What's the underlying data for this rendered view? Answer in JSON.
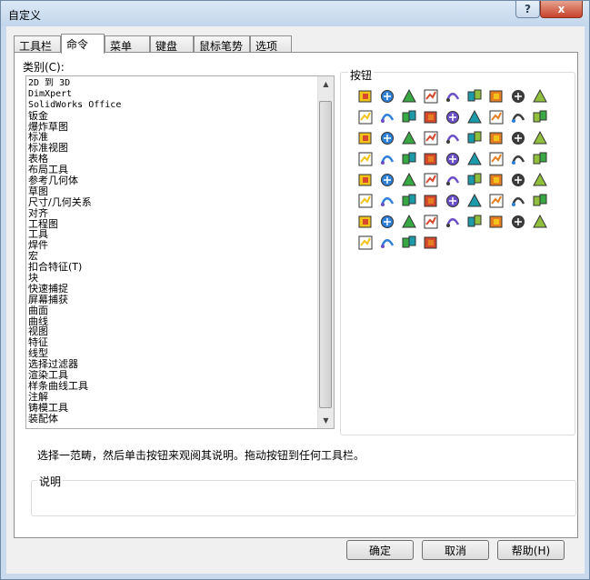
{
  "window": {
    "title": "自定义",
    "help": "?",
    "close": "x"
  },
  "tabs": [
    "工具栏",
    "命令",
    "菜单",
    "键盘",
    "鼠标笔势",
    "选项"
  ],
  "categories": {
    "label": "类别(C):",
    "items": [
      "2D 到 3D",
      "DimXpert",
      "SolidWorks Office",
      "钣金",
      "爆炸草图",
      "标准",
      "标准视图",
      "表格",
      "布局工具",
      "参考几何体",
      "草图",
      "尺寸/几何关系",
      "对齐",
      "工程图",
      "工具",
      "焊件",
      "宏",
      "扣合特征(T)",
      "块",
      "快速捕捉",
      "屏幕捕获",
      "曲面",
      "曲线",
      "视图",
      "特征",
      "线型",
      "选择过滤器",
      "渲染工具",
      "样条曲线工具",
      "注解",
      "铸模工具",
      "装配体"
    ]
  },
  "buttons": {
    "label": "按钮",
    "icons": [
      "import-3d-icon",
      "flowchart-icon",
      "text-a-icon",
      "box-3d-icon",
      "spiral-icon",
      "steps-icon",
      "target-icon",
      "grid-pattern-icon",
      "stairs-icon",
      "green-sphere-icon",
      "bold-italic-icon",
      "parallelogram-icon",
      "lines-icon",
      "bar-chart-icon",
      "frame-icon",
      "camera-target-icon",
      "sparkle-icon",
      "pie-chart-icon",
      "gear-icon",
      "cursor-icon",
      "pointer-click-icon",
      "percent-icon",
      "sw-3d-icon",
      "sw-r-icon",
      "save-disk-icon",
      "copy-pages-icon",
      "ruler-icon",
      "table-icon",
      "camera-icon",
      "part-cube-icon",
      "globe-icon",
      "chart-axis-icon",
      "picture-icon",
      "folder-open-icon",
      "floppy-icon",
      "printer-icon",
      "list-icon",
      "edit-pen-icon",
      "line-icon",
      "rectangle-icon",
      "slot-icon",
      "circle-dot-icon",
      "dotted-arc-icon",
      "ellipse-icon",
      "spline-icon",
      "point-plus-icon",
      "partial-rect-icon",
      "mirror-icon",
      "snap-grid-icon",
      "dot-grid-icon",
      "graph-icon",
      "move-icon",
      "sketch-box-icon",
      "cube-yellow-icon",
      "cylinder-icon",
      "pattern-dots-icon",
      "chain-icon",
      "folder-star-icon",
      "green-rects-icon",
      "rotate-icon",
      "assembly-icon",
      "swap-icon",
      "wave-icon",
      "screen-icon",
      "check-x-icon",
      "pliers-icon",
      "bar-step-icon"
    ]
  },
  "hint": "选择一范畴，然后单击按钮来观阅其说明。拖动按钮到任何工具栏。",
  "description": {
    "label": "说明"
  },
  "footer": {
    "ok": "确定",
    "cancel": "取消",
    "apply": "帮助(H)"
  }
}
